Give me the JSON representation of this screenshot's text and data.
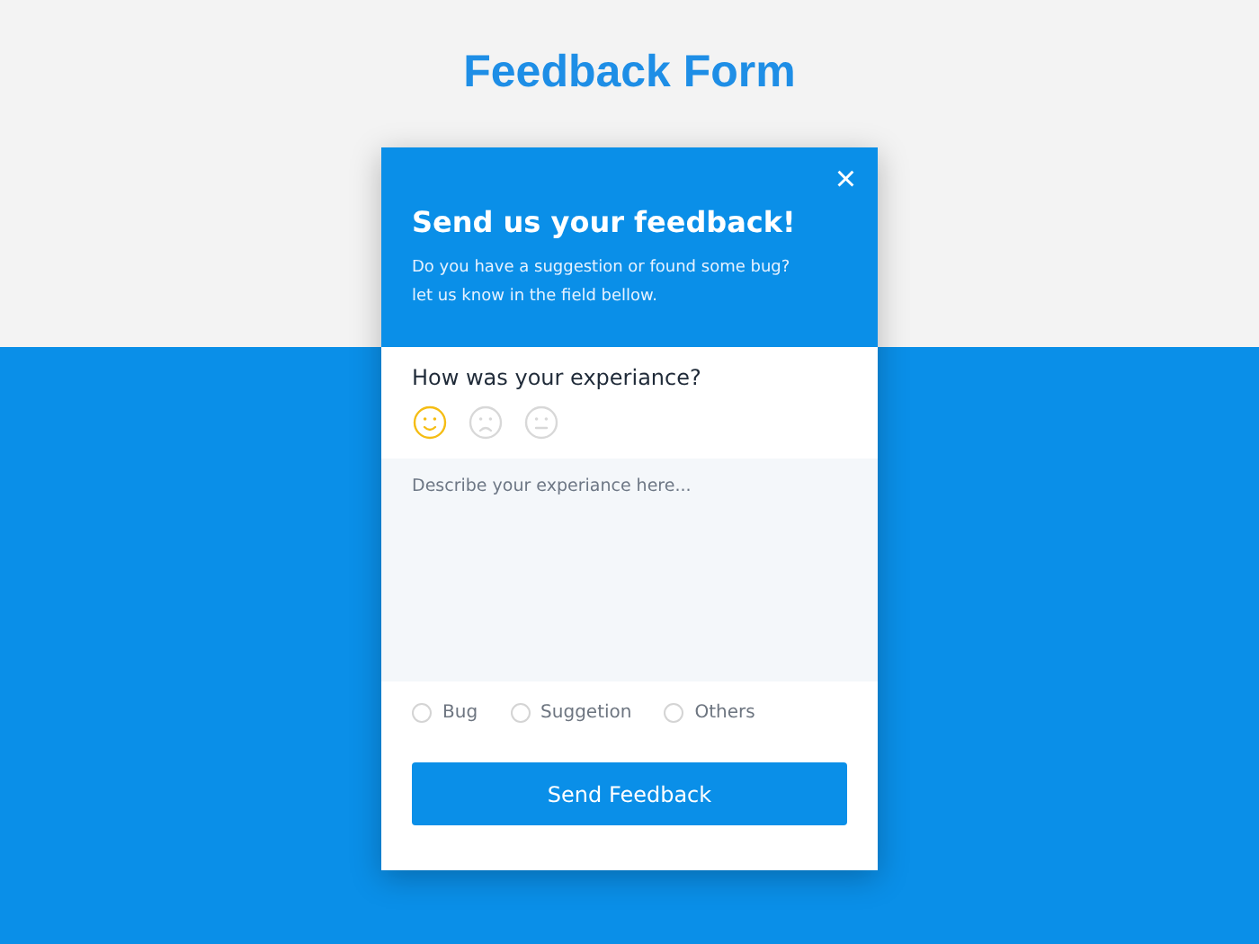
{
  "page_title": "Feedback Form",
  "dialog": {
    "close": "×",
    "title": "Send us your feedback!",
    "subtitle_lines": [
      "Do you have a suggestion or found some bug?",
      "let us know in the field bellow."
    ]
  },
  "rating": {
    "question": "How was your experiance?",
    "faces": [
      {
        "kind": "happy",
        "selected": true
      },
      {
        "kind": "sad",
        "selected": false
      },
      {
        "kind": "neutral",
        "selected": false
      }
    ]
  },
  "message": {
    "placeholder": "Describe your experiance here..."
  },
  "categories": [
    {
      "label": "Bug",
      "selected": false
    },
    {
      "label": "Suggetion",
      "selected": false
    },
    {
      "label": "Others",
      "selected": false
    }
  ],
  "submit": "Send Feedback"
}
